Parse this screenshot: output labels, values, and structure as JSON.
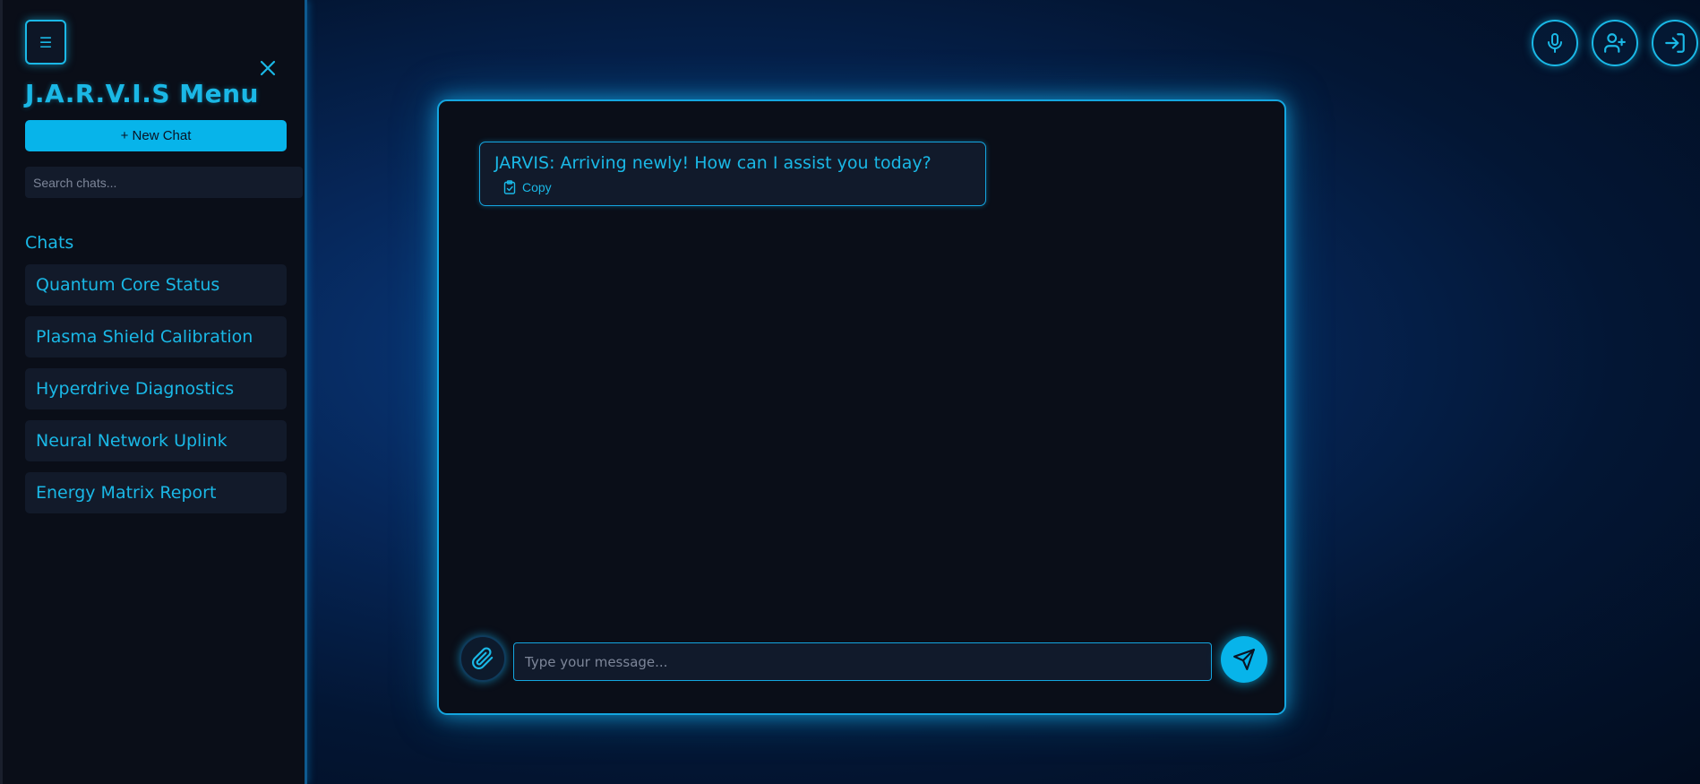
{
  "sidebar": {
    "toggle_glyph": "☰",
    "title": "J.A.R.V.I.S Menu",
    "new_chat_label": "+ New Chat",
    "search_placeholder": "Search chats...",
    "chats_heading": "Chats",
    "chats": [
      {
        "label": "Quantum Core Status"
      },
      {
        "label": "Plasma Shield Calibration"
      },
      {
        "label": "Hyperdrive Diagnostics"
      },
      {
        "label": "Neural Network Uplink"
      },
      {
        "label": "Energy Matrix Report"
      }
    ]
  },
  "header": {
    "icons": [
      "microphone-icon",
      "user-plus-icon",
      "sign-in-icon"
    ]
  },
  "chat": {
    "messages": [
      {
        "text": "JARVIS: Arriving newly! How can I assist you today?",
        "copy_label": "Copy"
      }
    ],
    "input_placeholder": "Type your message..."
  },
  "colors": {
    "accent": "#1ab8e6",
    "button_fill": "#07b4ea",
    "panel_bg": "#0a0e18",
    "item_bg": "#121a2a"
  }
}
